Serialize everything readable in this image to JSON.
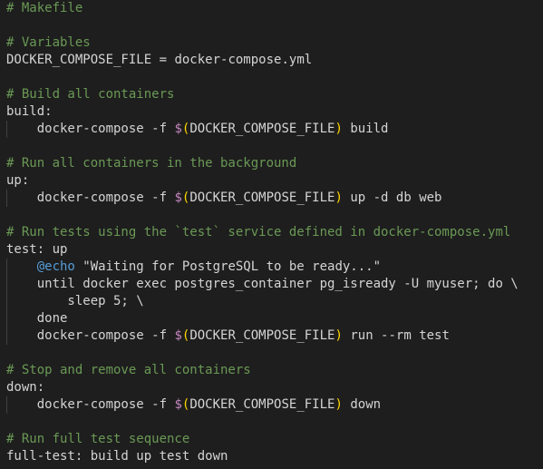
{
  "editor": {
    "language": "makefile",
    "lines": {
      "l1": "# Makefile",
      "l3": "# Variables",
      "l4_name": "DOCKER_COMPOSE_FILE",
      "l4_op": " = ",
      "l4_value": "docker-compose.yml",
      "l6": "# Build all containers",
      "l7": "build:",
      "l8_pre": "    docker-compose -f ",
      "l8_dollar": "$",
      "l8_open": "(",
      "l8_var": "DOCKER_COMPOSE_FILE",
      "l8_close": ")",
      "l8_post": " build",
      "l10": "# Run all containers in the background",
      "l11": "up:",
      "l12_pre": "    docker-compose -f ",
      "l12_dollar": "$",
      "l12_open": "(",
      "l12_var": "DOCKER_COMPOSE_FILE",
      "l12_close": ")",
      "l12_post": " up -d db web",
      "l14": "# Run tests using the `test` service defined in docker-compose.yml",
      "l15": "test: up",
      "l16_pre": "    ",
      "l16_at": "@echo",
      "l16_post": " \"Waiting for PostgreSQL to be ready...\"",
      "l17": "    until docker exec postgres_container pg_isready -U myuser; do \\",
      "l18": "        sleep 5; \\",
      "l19": "    done",
      "l20_pre": "    docker-compose -f ",
      "l20_dollar": "$",
      "l20_open": "(",
      "l20_var": "DOCKER_COMPOSE_FILE",
      "l20_close": ")",
      "l20_post": " run --rm test",
      "l22": "# Stop and remove all containers",
      "l23": "down:",
      "l24_pre": "    docker-compose -f ",
      "l24_dollar": "$",
      "l24_open": "(",
      "l24_var": "DOCKER_COMPOSE_FILE",
      "l24_close": ")",
      "l24_post": " down",
      "l26": "# Run full test sequence",
      "l27": "full-test: build up test down"
    }
  },
  "colors": {
    "background": "#1e1e1e",
    "comment": "#6a9955",
    "text": "#d4d4d4",
    "dollar": "#c586c0",
    "paren": "#ffd700",
    "echo": "#569cd6"
  }
}
